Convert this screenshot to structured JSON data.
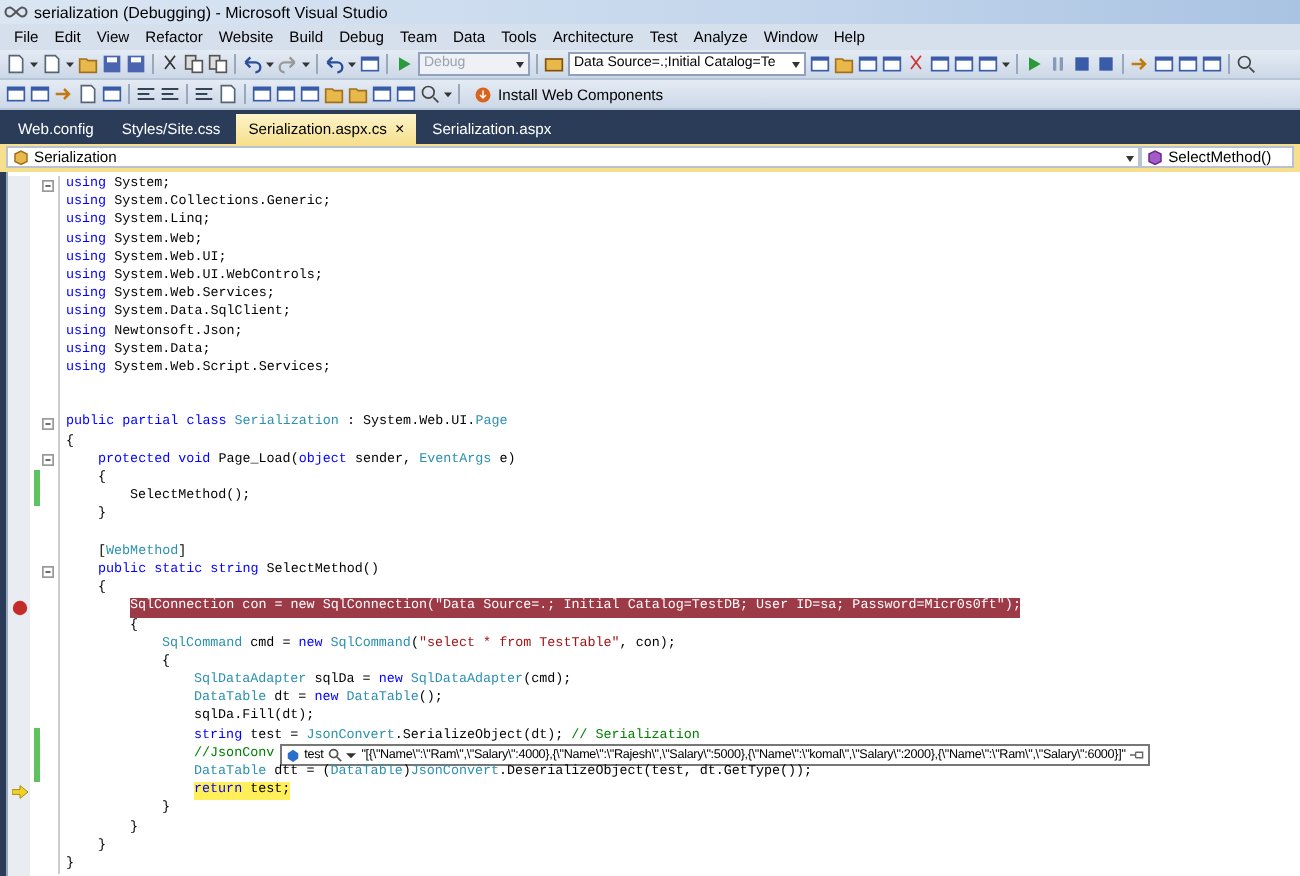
{
  "window": {
    "title": "serialization (Debugging) - Microsoft Visual Studio"
  },
  "menu": [
    "File",
    "Edit",
    "View",
    "Refactor",
    "Website",
    "Build",
    "Debug",
    "Team",
    "Data",
    "Tools",
    "Architecture",
    "Test",
    "Analyze",
    "Window",
    "Help"
  ],
  "toolbar": {
    "configuration": {
      "value": "Debug",
      "disabled": true
    },
    "connection": {
      "value": "Data Source=.;Initial Catalog=Te"
    },
    "install_button": "Install Web Components"
  },
  "tabs": [
    {
      "label": "Web.config",
      "selected": false
    },
    {
      "label": "Styles/Site.css",
      "selected": false
    },
    {
      "label": "Serialization.aspx.cs",
      "selected": true,
      "close": "×"
    },
    {
      "label": "Serialization.aspx",
      "selected": false
    }
  ],
  "navigation": {
    "type": "Serialization",
    "member": "SelectMethod()"
  },
  "code": {
    "lines": [
      {
        "kind": "code",
        "fold": true,
        "tokens": [
          {
            "text": "using",
            "kind": "keyword"
          },
          {
            "text": " System;",
            "kind": "plain"
          }
        ]
      },
      {
        "kind": "code",
        "tokens": [
          {
            "text": "using",
            "kind": "keyword"
          },
          {
            "text": " System.Collections.Generic;",
            "kind": "plain"
          }
        ]
      },
      {
        "kind": "code",
        "tokens": [
          {
            "text": "using",
            "kind": "keyword"
          },
          {
            "text": " System.Linq;",
            "kind": "plain"
          }
        ]
      },
      {
        "kind": "code",
        "tokens": [
          {
            "text": "using",
            "kind": "keyword"
          },
          {
            "text": " System.Web;",
            "kind": "plain"
          }
        ]
      },
      {
        "kind": "code",
        "tokens": [
          {
            "text": "using",
            "kind": "keyword"
          },
          {
            "text": " System.Web.UI;",
            "kind": "plain"
          }
        ]
      },
      {
        "kind": "code",
        "tokens": [
          {
            "text": "using",
            "kind": "keyword"
          },
          {
            "text": " System.Web.UI.WebControls;",
            "kind": "plain"
          }
        ]
      },
      {
        "kind": "code",
        "tokens": [
          {
            "text": "using",
            "kind": "keyword"
          },
          {
            "text": " System.Web.Services;",
            "kind": "plain"
          }
        ]
      },
      {
        "kind": "code",
        "tokens": [
          {
            "text": "using",
            "kind": "keyword"
          },
          {
            "text": " System.Data.SqlClient;",
            "kind": "plain"
          }
        ]
      },
      {
        "kind": "code",
        "tokens": [
          {
            "text": "using",
            "kind": "keyword"
          },
          {
            "text": " Newtonsoft.Json;",
            "kind": "plain"
          }
        ]
      },
      {
        "kind": "code",
        "tokens": [
          {
            "text": "using",
            "kind": "keyword"
          },
          {
            "text": " System.Data;",
            "kind": "plain"
          }
        ]
      },
      {
        "kind": "code",
        "tokens": [
          {
            "text": "using",
            "kind": "keyword"
          },
          {
            "text": " System.Web.Script.Services;",
            "kind": "plain"
          }
        ]
      },
      {
        "kind": "blank"
      },
      {
        "kind": "blank"
      },
      {
        "kind": "code",
        "fold": true,
        "tokens": [
          {
            "text": "public partial class",
            "kind": "keyword"
          },
          {
            "text": " Serialization",
            "kind": "type"
          },
          {
            "text": " : System.Web.UI.",
            "kind": "plain"
          },
          {
            "text": "Page",
            "kind": "type"
          }
        ]
      },
      {
        "kind": "code",
        "tokens": [
          {
            "text": "{",
            "kind": "plain"
          }
        ],
        "children": [
          {
            "kind": "code",
            "fold": true,
            "tokens": [
              {
                "text": "protected void",
                "kind": "keyword"
              },
              {
                "text": " Page_Load(",
                "kind": "plain"
              },
              {
                "text": "object",
                "kind": "keyword"
              },
              {
                "text": " sender, ",
                "kind": "plain"
              },
              {
                "text": "EventArgs",
                "kind": "type"
              },
              {
                "text": " e)",
                "kind": "plain"
              }
            ]
          },
          {
            "kind": "code",
            "changed": true,
            "tokens": [
              {
                "text": "{",
                "kind": "plain"
              }
            ],
            "children": [
              {
                "kind": "code",
                "changed": true,
                "tokens": [
                  {
                    "text": "SelectMethod();",
                    "kind": "plain"
                  }
                ]
              }
            ]
          },
          {
            "kind": "code",
            "tokens": [
              {
                "text": "}",
                "kind": "plain"
              }
            ]
          },
          {
            "kind": "blank"
          },
          {
            "kind": "code",
            "tokens": [
              {
                "text": "[",
                "kind": "plain"
              },
              {
                "text": "WebMethod",
                "kind": "type"
              },
              {
                "text": "]",
                "kind": "plain"
              }
            ]
          },
          {
            "kind": "code",
            "fold": true,
            "tokens": [
              {
                "text": "public static string",
                "kind": "keyword"
              },
              {
                "text": " SelectMethod()",
                "kind": "plain"
              }
            ]
          },
          {
            "kind": "code",
            "tokens": [
              {
                "text": "{",
                "kind": "plain"
              }
            ],
            "children": [
              {
                "kind": "code",
                "breakpoint": true,
                "tokens": [
                  {
                    "text": "SqlConnection con = new SqlConnection(\"Data Source=.; Initial Catalog=TestDB; User ID=sa; Password=Micr0s0ft\");",
                    "kind": "plain"
                  }
                ]
              },
              {
                "kind": "code",
                "tokens": [
                  {
                    "text": "{",
                    "kind": "plain"
                  }
                ],
                "children": [
                  {
                    "kind": "code",
                    "tokens": [
                      {
                        "text": "SqlCommand",
                        "kind": "type"
                      },
                      {
                        "text": " cmd = ",
                        "kind": "plain"
                      },
                      {
                        "text": "new",
                        "kind": "keyword"
                      },
                      {
                        "text": " SqlCommand",
                        "kind": "type"
                      },
                      {
                        "text": "(",
                        "kind": "plain"
                      },
                      {
                        "text": "\"select * from TestTable\"",
                        "kind": "string"
                      },
                      {
                        "text": ", con);",
                        "kind": "plain"
                      }
                    ]
                  },
                  {
                    "kind": "code",
                    "tokens": [
                      {
                        "text": "{",
                        "kind": "plain"
                      }
                    ],
                    "children": [
                      {
                        "kind": "code",
                        "tokens": [
                          {
                            "text": "SqlDataAdapter",
                            "kind": "type"
                          },
                          {
                            "text": " sqlDa = ",
                            "kind": "plain"
                          },
                          {
                            "text": "new",
                            "kind": "keyword"
                          },
                          {
                            "text": " SqlDataAdapter",
                            "kind": "type"
                          },
                          {
                            "text": "(cmd);",
                            "kind": "plain"
                          }
                        ]
                      },
                      {
                        "kind": "code",
                        "tokens": [
                          {
                            "text": "DataTable",
                            "kind": "type"
                          },
                          {
                            "text": " dt = ",
                            "kind": "plain"
                          },
                          {
                            "text": "new",
                            "kind": "keyword"
                          },
                          {
                            "text": " DataTable",
                            "kind": "type"
                          },
                          {
                            "text": "();",
                            "kind": "plain"
                          }
                        ]
                      },
                      {
                        "kind": "code",
                        "tokens": [
                          {
                            "text": "sqlDa.Fill(dt);",
                            "kind": "plain"
                          }
                        ]
                      },
                      {
                        "kind": "code",
                        "changed": true,
                        "tokens": [
                          {
                            "text": "string",
                            "kind": "keyword"
                          },
                          {
                            "text": " test = ",
                            "kind": "plain"
                          },
                          {
                            "text": "JsonConvert",
                            "kind": "type"
                          },
                          {
                            "text": ".SerializeObject(dt); ",
                            "kind": "plain"
                          },
                          {
                            "text": "// Serialization",
                            "kind": "comment"
                          }
                        ]
                      },
                      {
                        "kind": "code",
                        "changed": true,
                        "tokens": [
                          {
                            "text": "//JsonConv",
                            "kind": "comment"
                          }
                        ],
                        "datatip": {
                          "name": "test",
                          "value": "\"[{\\\"Name\\\":\\\"Ram\\\",\\\"Salary\\\":4000},{\\\"Name\\\":\\\"Rajesh\\\",\\\"Salary\\\":5000},{\\\"Name\\\":\\\"komal\\\",\\\"Salary\\\":2000},{\\\"Name\\\":\\\"Ram\\\",\\\"Salary\\\":6000}]\""
                        }
                      },
                      {
                        "kind": "code",
                        "changed": true,
                        "tokens": [
                          {
                            "text": "DataTable",
                            "kind": "type"
                          },
                          {
                            "text": " dtt = (",
                            "kind": "plain"
                          },
                          {
                            "text": "DataTable",
                            "kind": "type"
                          },
                          {
                            "text": ")",
                            "kind": "plain"
                          },
                          {
                            "text": "JsonConvert",
                            "kind": "type"
                          },
                          {
                            "text": ".DeserializeObject(test, dt.GetType());",
                            "kind": "plain"
                          }
                        ]
                      },
                      {
                        "kind": "code",
                        "current": true,
                        "tokens": [
                          {
                            "text": "return",
                            "kind": "keyword"
                          },
                          {
                            "text": " test;",
                            "kind": "plain"
                          }
                        ]
                      }
                    ]
                  },
                  {
                    "kind": "code",
                    "tokens": [
                      {
                        "text": "}",
                        "kind": "plain"
                      }
                    ]
                  }
                ]
              },
              {
                "kind": "code",
                "tokens": [
                  {
                    "text": "}",
                    "kind": "plain"
                  }
                ]
              }
            ]
          },
          {
            "kind": "code",
            "tokens": [
              {
                "text": "}",
                "kind": "plain"
              }
            ]
          }
        ]
      },
      {
        "kind": "code",
        "tokens": [
          {
            "text": "}",
            "kind": "plain"
          }
        ]
      }
    ]
  }
}
